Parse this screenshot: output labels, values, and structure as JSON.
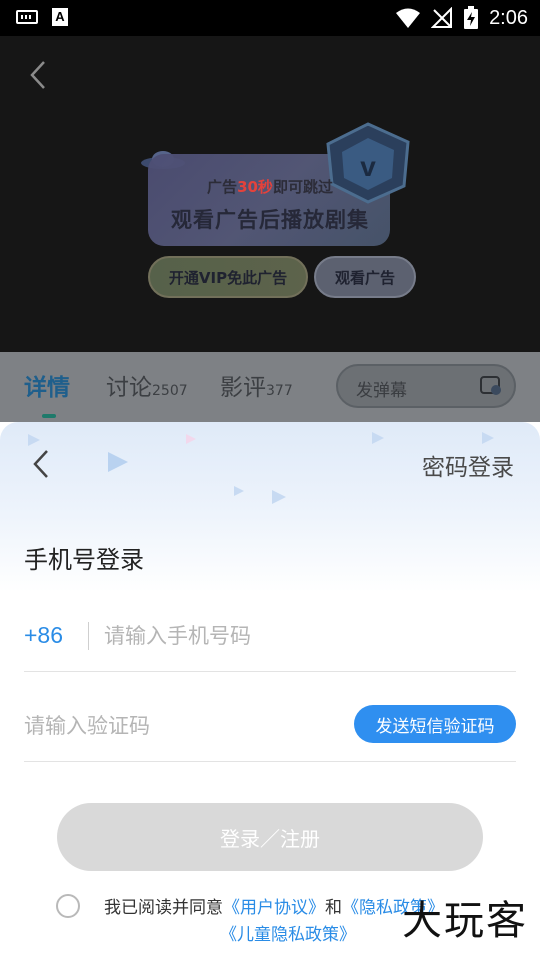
{
  "status_bar": {
    "time": "2:06",
    "a_icon_text": "A"
  },
  "ad": {
    "line1_prefix": "广告",
    "line1_highlight": "30秒",
    "line1_suffix": "即可跳过",
    "line2": "观看广告后播放剧集",
    "vip_button": "开通VIP免此广告",
    "watch_button": "观看广告"
  },
  "tabs": {
    "details": "详情",
    "discussion": "讨论",
    "discussion_count": "2507",
    "reviews": "影评",
    "reviews_count": "377",
    "danmu_placeholder": "发弹幕"
  },
  "login": {
    "password_login": "密码登录",
    "title": "手机号登录",
    "country_code": "+86",
    "phone_placeholder": "请输入手机号码",
    "code_placeholder": "请输入验证码",
    "send_code": "发送短信验证码",
    "submit": "登录／注册",
    "agree_prefix": "我已阅读并同意",
    "user_agreement": "《用户协议》",
    "and": "和",
    "privacy_policy": "《隐私政策》",
    "child_privacy": "《儿童隐私政策》"
  },
  "watermark": "大玩客",
  "colors": {
    "accent": "#2f8ff0",
    "link": "#2a8ce6",
    "disabled": "#d9d9d9"
  }
}
